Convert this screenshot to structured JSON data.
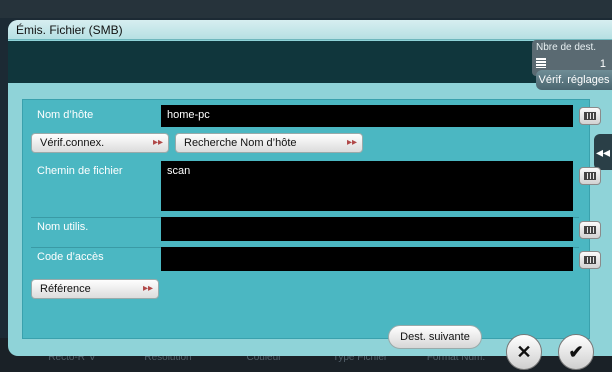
{
  "dialog": {
    "title": "Émis. Fichier (SMB)",
    "dest_count_label": "Nbre de dest.",
    "dest_count_value": "1",
    "verify_settings": "Vérif. réglages",
    "side_tab": "◂◂"
  },
  "form": {
    "hostname_label": "Nom d’hôte",
    "hostname_value": "home-pc",
    "check_connection": "Vérif.connex.",
    "search_host": "Recherche Nom d’hôte",
    "path_label": "Chemin de fichier",
    "path_value": "scan",
    "username_label": "Nom utilis.",
    "username_value": "",
    "password_label": "Code d’accès",
    "password_value": "",
    "reference": "Référence"
  },
  "footer": {
    "next_dest": "Dest. suivante",
    "cancel_symbol": "✕",
    "ok_symbol": "✔",
    "background_tabs": [
      "Recto-R°V",
      "Résolution",
      "Couleur",
      "Type Fichier",
      "Format Num."
    ]
  },
  "icons": {
    "keyboard": "keyboard-icon",
    "arrow": "double-arrow-right-icon"
  }
}
